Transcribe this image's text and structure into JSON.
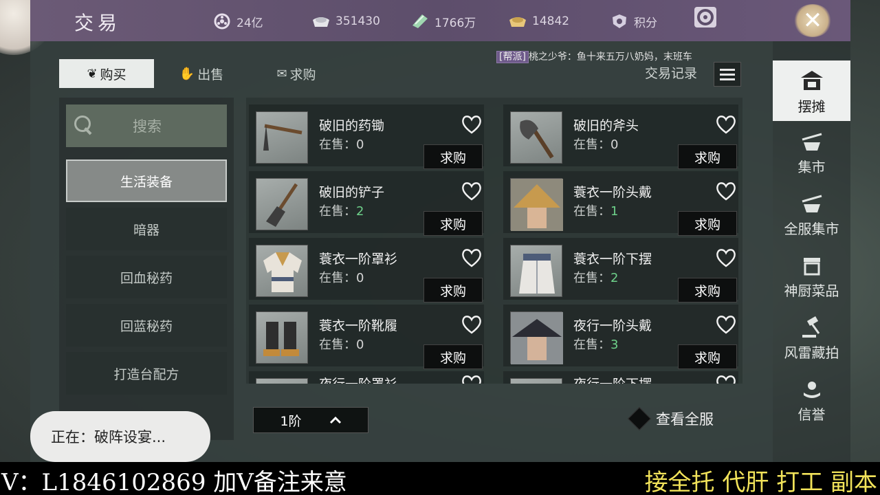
{
  "title": "交易",
  "currencies": [
    {
      "icon": "coin-reel-icon",
      "value": "24亿"
    },
    {
      "icon": "silver-ingot-icon",
      "value": "351430"
    },
    {
      "icon": "jade-ticket-icon",
      "value": "1766万"
    },
    {
      "icon": "gold-ingot-icon",
      "value": "14842"
    },
    {
      "icon": "points-shield-icon",
      "value": "积分"
    }
  ],
  "notice": {
    "tag": "[帮派]",
    "text": "桃之少爷：鱼十来五万八奶妈，末班车"
  },
  "tabs": [
    {
      "label": "购买",
      "icon": "ink-brush-icon",
      "active": true
    },
    {
      "label": "出售",
      "icon": "hand-sell-icon",
      "active": false
    },
    {
      "label": "求购",
      "icon": "request-icon",
      "active": false
    }
  ],
  "records_label": "交易记录",
  "search_label": "搜索",
  "categories": [
    "生活装备",
    "暗器",
    "回血秘药",
    "回蓝秘药",
    "打造台配方"
  ],
  "stock_prefix": "在售：",
  "buy_label": "求购",
  "items": [
    {
      "name": "破旧的药锄",
      "stock": "0"
    },
    {
      "name": "破旧的斧头",
      "stock": "0"
    },
    {
      "name": "破旧的铲子",
      "stock": "2"
    },
    {
      "name": "蓑衣一阶头戴",
      "stock": "1"
    },
    {
      "name": "蓑衣一阶罩衫",
      "stock": "0"
    },
    {
      "name": "蓑衣一阶下摆",
      "stock": "2"
    },
    {
      "name": "蓑衣一阶靴履",
      "stock": "0"
    },
    {
      "name": "夜行一阶头戴",
      "stock": "3"
    },
    {
      "name": "夜行一阶罩衫",
      "stock": ""
    },
    {
      "name": "夜行一阶下摆",
      "stock": ""
    }
  ],
  "tier_label": "1阶",
  "view_all_label": "查看全服",
  "right_nav": [
    {
      "label": "摆摊",
      "icon": "stall-icon",
      "active": true
    },
    {
      "label": "集市",
      "icon": "market-cart-icon",
      "active": false
    },
    {
      "label": "全服集市",
      "icon": "server-market-icon",
      "active": false
    },
    {
      "label": "神厨菜品",
      "icon": "kitchen-icon",
      "active": false
    },
    {
      "label": "风雷藏拍",
      "icon": "auction-hammer-icon",
      "active": false
    },
    {
      "label": "信誉",
      "icon": "reputation-icon",
      "active": false
    }
  ],
  "status_toast": "正在：破阵设宴...",
  "banner": {
    "left": "V：L1846102869 加V备注来意",
    "right": "接全托 代肝 打工 副本"
  },
  "colors": {
    "stock_positive": "#6ed18a",
    "topbar": "#5d4e6b",
    "banner_right": "#f2e35a"
  }
}
